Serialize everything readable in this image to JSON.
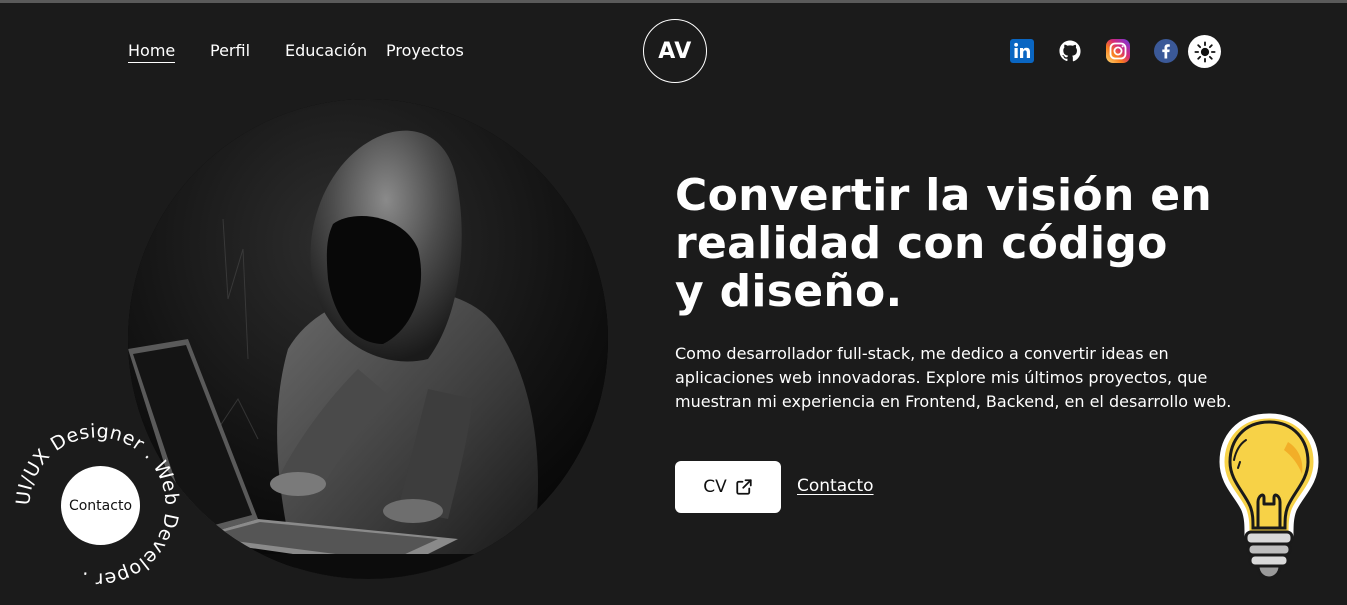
{
  "nav": {
    "items": [
      {
        "label": "Home",
        "active": true
      },
      {
        "label": "Perfil",
        "active": false
      },
      {
        "label": "Educación",
        "active": false
      },
      {
        "label": "Proyectos",
        "active": false
      }
    ]
  },
  "logo": {
    "text": "AV"
  },
  "social": [
    {
      "name": "linkedin-icon",
      "color": "#0a66c2"
    },
    {
      "name": "github-icon",
      "color": "#ffffff"
    },
    {
      "name": "instagram-icon",
      "color": "#e1306c"
    },
    {
      "name": "facebook-icon",
      "color": "#3b5998"
    }
  ],
  "theme_toggle": {
    "icon": "sun-icon"
  },
  "hero": {
    "image_icon": "hooded-figure-laptop-image",
    "headline_line1": "Convertir la visión en",
    "headline_line2": "realidad con código",
    "headline_line3": "y diseño.",
    "description": "Como desarrollador full-stack, me dedico a convertir ideas en aplicaciones web innovadoras. Explore mis últimos proyectos, que muestran mi experiencia en Frontend, Backend, en el desarrollo web.",
    "cv_label": "CV",
    "contact_label": "Contacto"
  },
  "badge": {
    "ring_text": "UI/UX Designer . Web Developer . ",
    "button_label": "Contacto"
  },
  "colors": {
    "background": "#1b1b1b",
    "text": "#ffffff",
    "bulb": "#f7d247"
  }
}
